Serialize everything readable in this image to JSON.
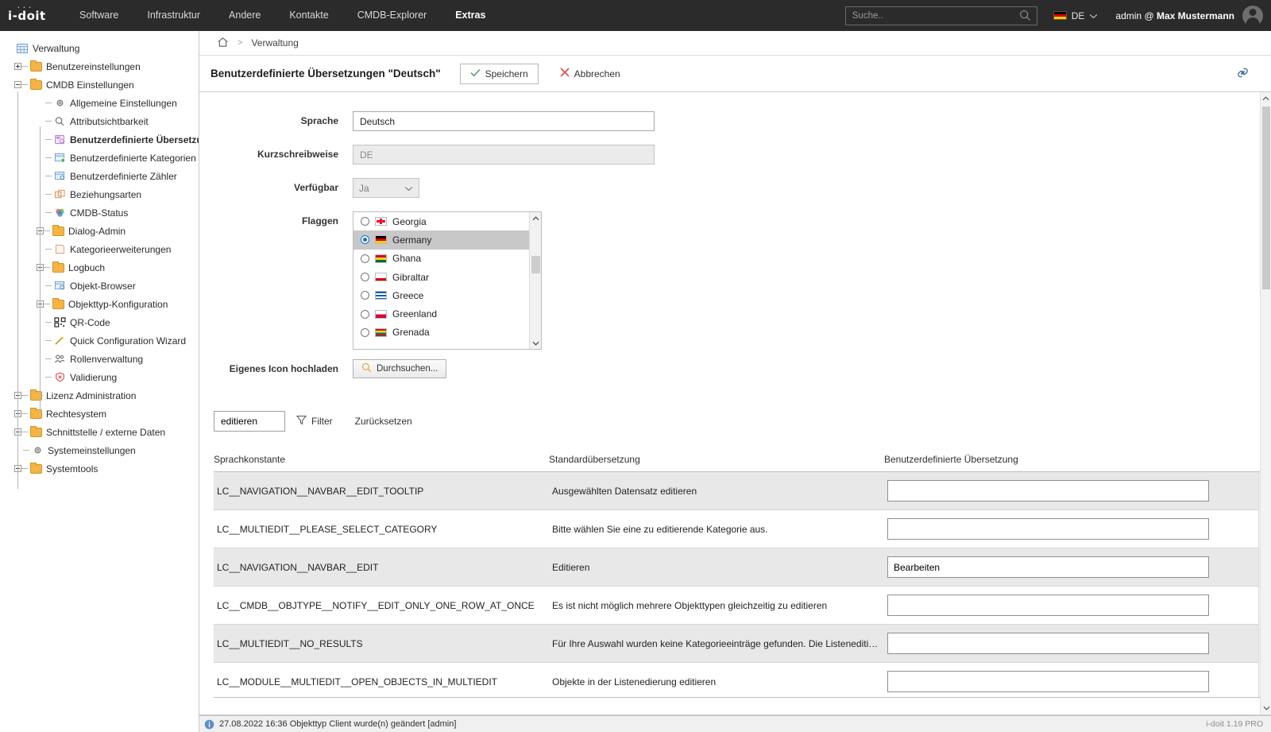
{
  "app": {
    "logo": "i-doit",
    "version_label": "i-doit 1.19 PRO"
  },
  "topnav": {
    "items": [
      {
        "label": "Software",
        "active": false
      },
      {
        "label": "Infrastruktur",
        "active": false
      },
      {
        "label": "Andere",
        "active": false
      },
      {
        "label": "Kontakte",
        "active": false
      },
      {
        "label": "CMDB-Explorer",
        "active": false
      },
      {
        "label": "Extras",
        "active": true
      }
    ],
    "search": {
      "placeholder": "Suche..",
      "value": "",
      "icon": "search-icon"
    },
    "language": {
      "code": "DE",
      "flag": "germany-flag-icon",
      "chevron": "chevron-down-icon"
    },
    "user": {
      "text": "admin @ ",
      "name": "Max Mustermann",
      "avatar": "user-avatar-icon"
    }
  },
  "sidebar": {
    "root": {
      "label": "Verwaltung",
      "icon": "grid-icon"
    },
    "items": [
      {
        "label": "Benutzereinstellungen",
        "icon": "folder-icon",
        "expander": "plus",
        "depth": 1,
        "bold": false
      },
      {
        "label": "CMDB Einstellungen",
        "icon": "folder-icon",
        "expander": "minus",
        "depth": 1,
        "bold": false
      },
      {
        "label": "Allgemeine Einstellungen",
        "icon": "gear-icon",
        "expander": "none",
        "depth": 2,
        "bold": false
      },
      {
        "label": "Attributsichtbarkeit",
        "icon": "magnifier-icon",
        "expander": "none",
        "depth": 2,
        "bold": false
      },
      {
        "label": "Benutzerdefinierte Übersetzu...",
        "icon": "translation-icon",
        "expander": "none",
        "depth": 2,
        "bold": true
      },
      {
        "label": "Benutzerdefinierte Kategorien",
        "icon": "category-icon",
        "expander": "none",
        "depth": 2,
        "bold": false
      },
      {
        "label": "Benutzerdefinierte Zähler",
        "icon": "counter-icon",
        "expander": "none",
        "depth": 2,
        "bold": false
      },
      {
        "label": "Beziehungsarten",
        "icon": "relation-icon",
        "expander": "none",
        "depth": 2,
        "bold": false
      },
      {
        "label": "CMDB-Status",
        "icon": "status-icon",
        "expander": "none",
        "depth": 2,
        "bold": false
      },
      {
        "label": "Dialog-Admin",
        "icon": "folder-icon",
        "expander": "plus",
        "depth": 2,
        "bold": false
      },
      {
        "label": "Kategorieerweiterungen",
        "icon": "extension-icon",
        "expander": "none",
        "depth": 2,
        "bold": false
      },
      {
        "label": "Logbuch",
        "icon": "folder-icon",
        "expander": "plus",
        "depth": 2,
        "bold": false
      },
      {
        "label": "Objekt-Browser",
        "icon": "browser-icon",
        "expander": "none",
        "depth": 2,
        "bold": false
      },
      {
        "label": "Objekttyp-Konfiguration",
        "icon": "folder-icon",
        "expander": "plus",
        "depth": 2,
        "bold": false
      },
      {
        "label": "QR-Code",
        "icon": "qr-code-icon",
        "expander": "none",
        "depth": 2,
        "bold": false
      },
      {
        "label": "Quick Configuration Wizard",
        "icon": "wand-icon",
        "expander": "none",
        "depth": 2,
        "bold": false
      },
      {
        "label": "Rollenverwaltung",
        "icon": "users-icon",
        "expander": "none",
        "depth": 2,
        "bold": false
      },
      {
        "label": "Validierung",
        "icon": "shield-icon",
        "expander": "none",
        "depth": 2,
        "bold": false
      },
      {
        "label": "Lizenz Administration",
        "icon": "folder-icon",
        "expander": "plus",
        "depth": 1,
        "bold": false
      },
      {
        "label": "Rechtesystem",
        "icon": "folder-icon",
        "expander": "plus",
        "depth": 1,
        "bold": false
      },
      {
        "label": "Schnittstelle / externe Daten",
        "icon": "folder-icon",
        "expander": "plus",
        "depth": 1,
        "bold": false
      },
      {
        "label": "Systemeinstellungen",
        "icon": "gear-icon",
        "expander": "none",
        "depth": 1,
        "bold": false
      },
      {
        "label": "Systemtools",
        "icon": "folder-icon",
        "expander": "plus",
        "depth": 1,
        "bold": false
      }
    ]
  },
  "breadcrumb": {
    "home_icon": "home-icon",
    "separator": ">",
    "current": "Verwaltung"
  },
  "titlebar": {
    "title": "Benutzerdefinierte Übersetzungen \"Deutsch\"",
    "save_label": "Speichern",
    "cancel_label": "Abbrechen",
    "link_icon": "link-icon"
  },
  "form": {
    "language": {
      "label": "Sprache",
      "value": "Deutsch"
    },
    "shortcode": {
      "label": "Kurzschreibweise",
      "value": "DE",
      "disabled": true
    },
    "available": {
      "label": "Verfügbar",
      "value": "Ja"
    },
    "flags": {
      "label": "Flaggen",
      "options": [
        {
          "label": "Georgia",
          "selected": false
        },
        {
          "label": "Germany",
          "selected": true
        },
        {
          "label": "Ghana",
          "selected": false
        },
        {
          "label": "Gibraltar",
          "selected": false
        },
        {
          "label": "Greece",
          "selected": false
        },
        {
          "label": "Greenland",
          "selected": false
        },
        {
          "label": "Grenada",
          "selected": false
        }
      ]
    },
    "upload": {
      "label": "Eigenes Icon hochladen",
      "button_label": "Durchsuchen...",
      "icon": "magnifier-icon"
    }
  },
  "filter": {
    "input_value": "editieren",
    "filter_label": "Filter",
    "filter_icon": "funnel-icon",
    "reset_label": "Zurücksetzen"
  },
  "table": {
    "columns": [
      "Sprachkonstante",
      "Standardübersetzung",
      "Benutzerdefinierte Übersetzung"
    ],
    "rows": [
      {
        "constant": "LC__NAVIGATION__NAVBAR__EDIT_TOOLTIP",
        "standard": "Ausgewählten Datensatz editieren",
        "custom": ""
      },
      {
        "constant": "LC__MULTIEDIT__PLEASE_SELECT_CATEGORY",
        "standard": "Bitte wählen Sie eine zu editierende Kategorie aus.",
        "custom": ""
      },
      {
        "constant": "LC__NAVIGATION__NAVBAR__EDIT",
        "standard": "Editieren",
        "custom": "Bearbeiten"
      },
      {
        "constant": "LC__CMDB__OBJTYPE__NOTIFY__EDIT_ONLY_ONE_ROW_AT_ONCE",
        "standard": "Es ist nicht möglich mehrere Objekttypen gleichzeitig zu editieren",
        "custom": ""
      },
      {
        "constant": "LC__MULTIEDIT__NO_RESULTS",
        "standard": "Für Ihre Auswahl wurden keine Kategorieeinträge gefunden. Die Listeneditierung ermögl...",
        "custom": ""
      },
      {
        "constant": "LC__MODULE__MULTIEDIT__OPEN_OBJECTS_IN_MULTIEDIT",
        "standard": "Objekte in der Listenedierung editieren",
        "custom": ""
      }
    ]
  },
  "statusbar": {
    "icon": "info-icon",
    "message": "27.08.2022 16:36 Objekttyp Client wurde(n) geändert [admin]",
    "right": "i-doit 1.19 PRO"
  },
  "colors": {
    "nav_bg": "#2b2b2b",
    "accent_blue": "#1570c8",
    "folder": "#f6b445",
    "save_check": "#4a9e6a",
    "cancel_x": "#d9534f"
  }
}
